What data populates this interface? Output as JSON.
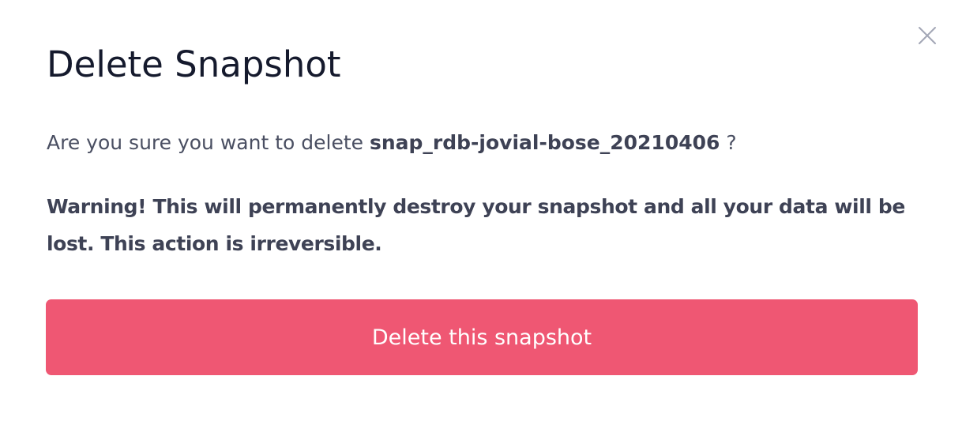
{
  "dialog": {
    "title": "Delete Snapshot",
    "question_prefix": "Are you sure you want to delete ",
    "snapshot_name": "snap_rdb-jovial-bose_20210406",
    "question_suffix": " ?",
    "warning": "Warning! This will permanently destroy your snapshot and all your data will be lost. This action is irreversible.",
    "confirm_label": "Delete this snapshot",
    "close_icon": "close-icon"
  },
  "colors": {
    "title": "#151a2d",
    "body_text": "#4a4f62",
    "danger": "#ef5773",
    "close_icon": "#a3a7b6"
  }
}
